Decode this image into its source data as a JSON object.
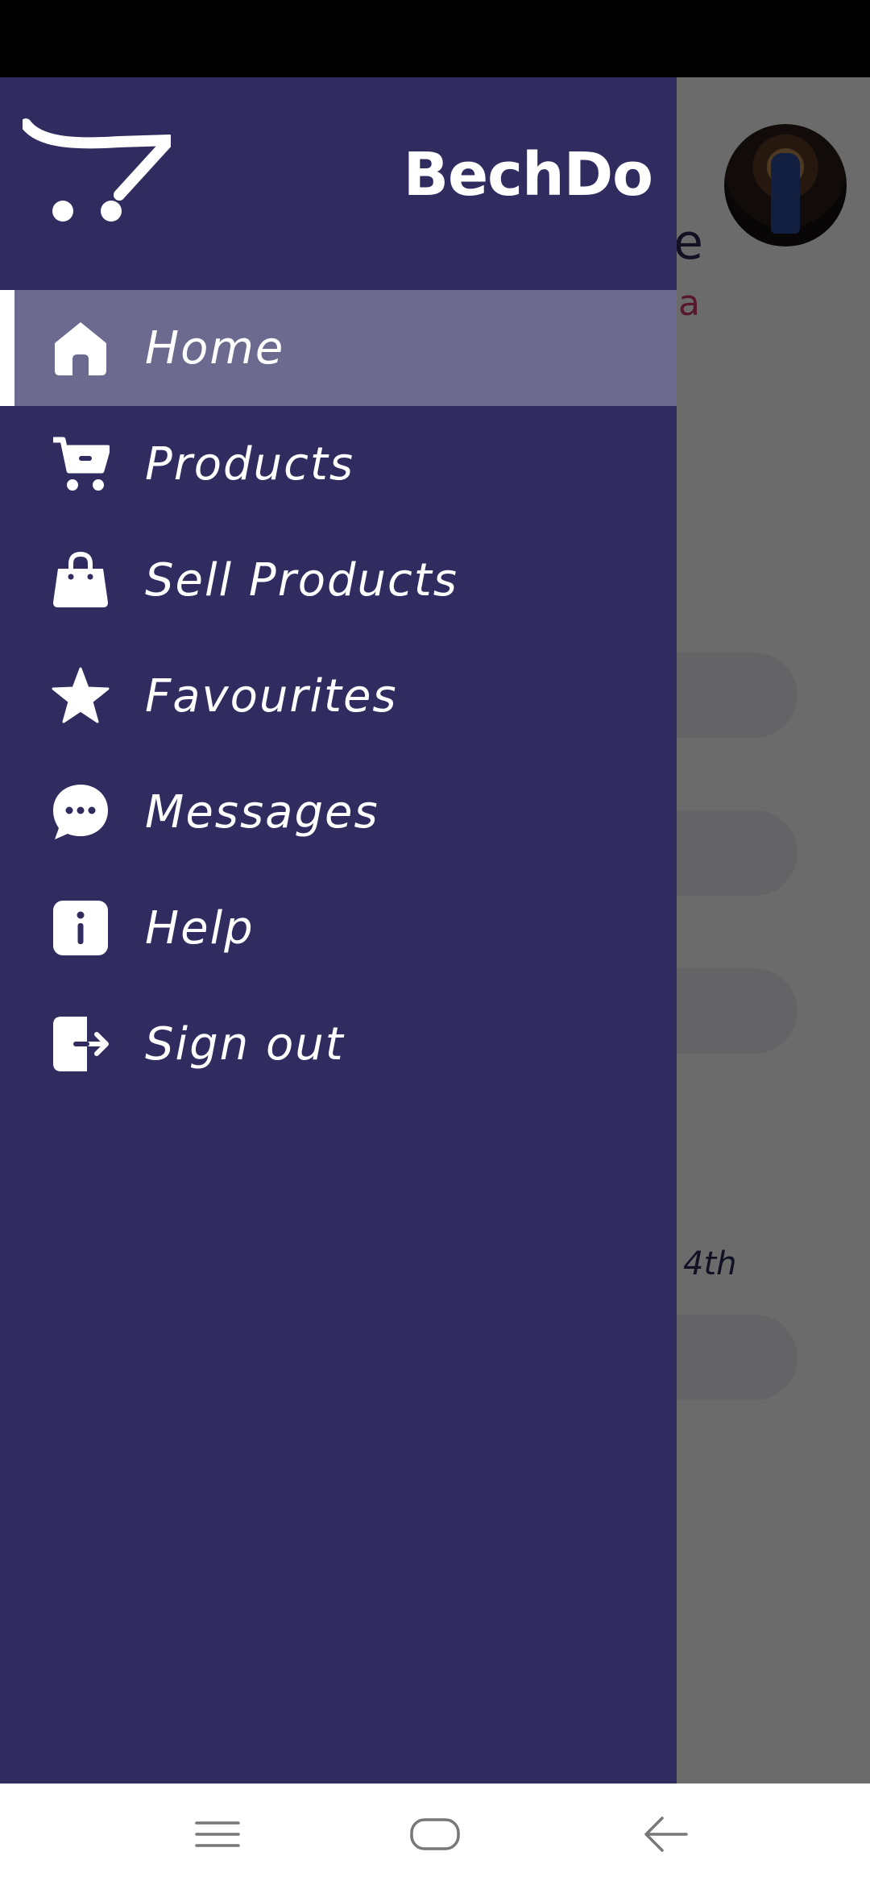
{
  "background": {
    "partial_title": "e",
    "partial_subtitle": "a",
    "partial_text": "4th"
  },
  "drawer": {
    "brand": "BechDo",
    "items": [
      {
        "label": "Home",
        "icon": "home-icon",
        "active": true
      },
      {
        "label": "Products",
        "icon": "cart-icon"
      },
      {
        "label": "Sell Products",
        "icon": "shopping-bag-icon"
      },
      {
        "label": "Favourites",
        "icon": "star-icon"
      },
      {
        "label": "Messages",
        "icon": "chat-bubble-icon"
      },
      {
        "label": "Help",
        "icon": "info-icon"
      },
      {
        "label": "Sign out",
        "icon": "sign-out-icon"
      }
    ]
  },
  "navbar": {
    "buttons": [
      "menu-icon",
      "home-outline-icon",
      "back-arrow-icon"
    ]
  },
  "colors": {
    "drawer_bg": "#312c5f",
    "active_item_bg": "#6c6b8f",
    "accent_pink": "#d2386b"
  }
}
